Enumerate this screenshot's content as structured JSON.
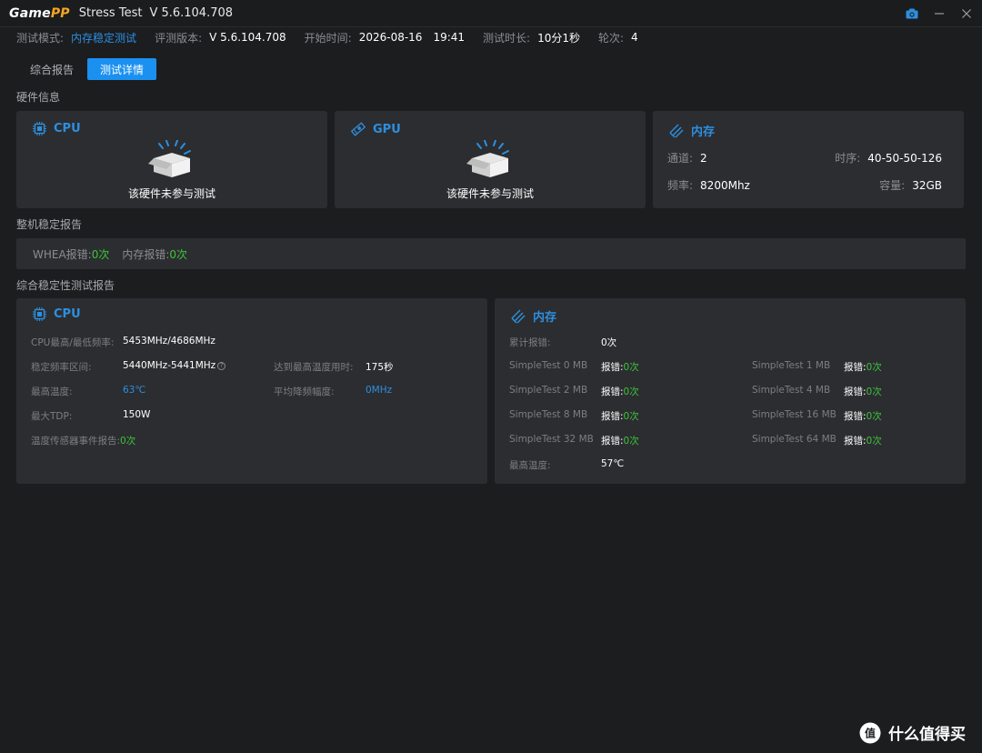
{
  "titlebar": {
    "logo_game": "Game",
    "logo_pp": "PP",
    "title": "Stress Test",
    "version": "V 5.6.104.708"
  },
  "info": {
    "mode_label": "测试模式:",
    "mode_value": "内存稳定测试",
    "eval_version_label": "评测版本:",
    "eval_version_value": "V 5.6.104.708",
    "start_label": "开始时间:",
    "start_date": "2026-08-16",
    "start_time": "19:41",
    "duration_label": "测试时长:",
    "duration_value": "10分1秒",
    "rounds_label": "轮次:",
    "rounds_value": "4"
  },
  "tabs": [
    {
      "label": "综合报告"
    },
    {
      "label": "测试详情"
    }
  ],
  "hardware": {
    "section_title": "硬件信息",
    "cpu": {
      "title": "CPU",
      "status": "该硬件未参与测试"
    },
    "gpu": {
      "title": "GPU",
      "status": "该硬件未参与测试"
    },
    "memory": {
      "title": "内存",
      "channel_label": "通道:",
      "channel_value": "2",
      "timing_label": "时序:",
      "timing_value": "40-50-50-126",
      "freq_label": "频率:",
      "freq_value": "8200Mhz",
      "capacity_label": "容量:",
      "capacity_value": "32GB"
    }
  },
  "stability": {
    "section_title": "整机稳定报告",
    "whea_label": "WHEA报错:",
    "whea_value": "0次",
    "mem_err_label": "内存报错:",
    "mem_err_value": "0次"
  },
  "report": {
    "section_title": "综合稳定性测试报告",
    "cpu": {
      "title": "CPU",
      "max_min_freq_label": "CPU最高/最低频率:",
      "max_min_freq_value": "5453MHz/4686MHz",
      "stable_range_label": "稳定频率区间:",
      "stable_range_value": "5440MHz-5441MHz",
      "max_temp_time_label": "达到最高温度用时:",
      "max_temp_time_value": "175秒",
      "max_temp_label": "最高温度:",
      "max_temp_value": "63℃",
      "avg_throttle_label": "平均降频幅度:",
      "avg_throttle_value": "0MHz",
      "max_tdp_label": "最大TDP:",
      "max_tdp_value": "150W",
      "sensor_label": "温度传感器事件报告:",
      "sensor_value": "0次"
    },
    "memory": {
      "title": "内存",
      "total_err_label": "累计报错:",
      "total_err_value": "0次",
      "err_label": "报错:",
      "tests": [
        {
          "name": "SimpleTest 0 MB",
          "value": "0次"
        },
        {
          "name": "SimpleTest 1 MB",
          "value": "0次"
        },
        {
          "name": "SimpleTest 2 MB",
          "value": "0次"
        },
        {
          "name": "SimpleTest 4 MB",
          "value": "0次"
        },
        {
          "name": "SimpleTest 8 MB",
          "value": "0次"
        },
        {
          "name": "SimpleTest 16 MB",
          "value": "0次"
        },
        {
          "name": "SimpleTest 32 MB",
          "value": "0次"
        },
        {
          "name": "SimpleTest 64 MB",
          "value": "0次"
        }
      ],
      "max_temp_label": "最高温度:",
      "max_temp_value": "57℃"
    }
  },
  "watermark": {
    "text": "什么值得买",
    "badge": "值"
  },
  "colors": {
    "accent": "#1a90f0",
    "link": "#2c8fe0",
    "ok": "#3cc43c",
    "panel": "#2c2d30",
    "bg": "#1c1d1f"
  }
}
